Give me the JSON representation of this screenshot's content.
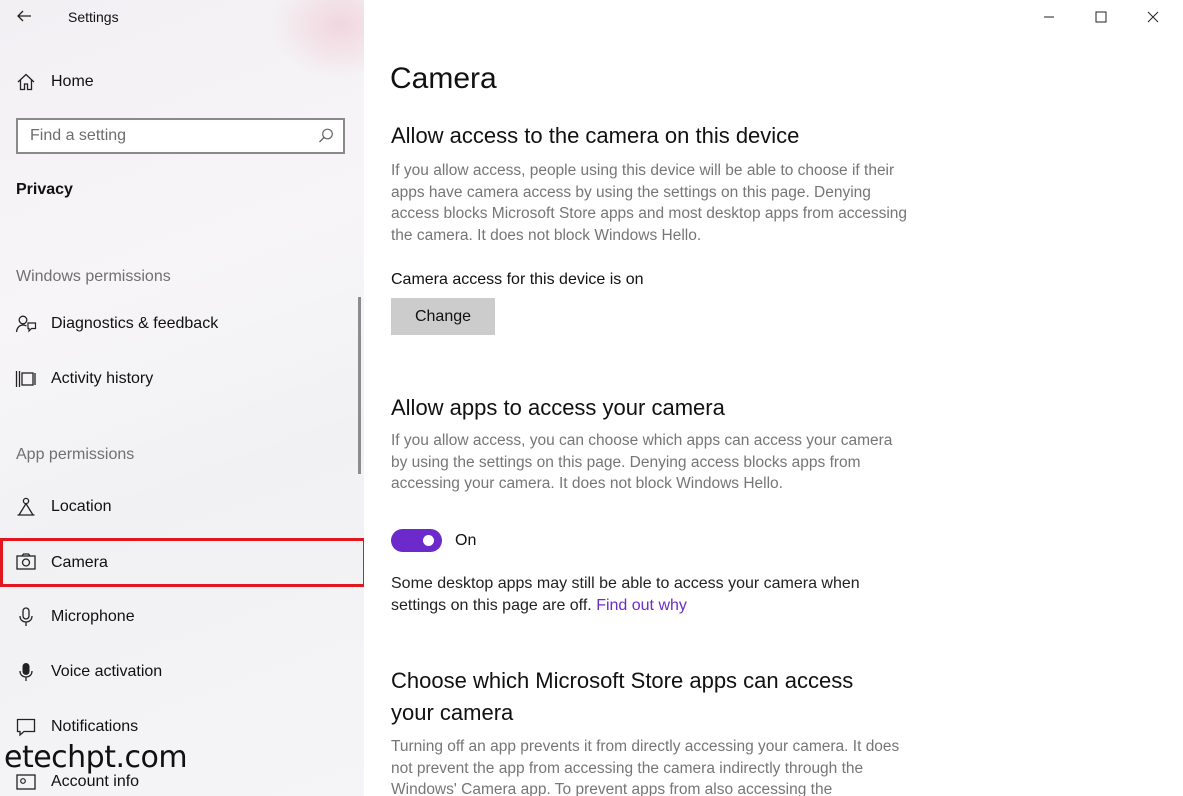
{
  "window": {
    "title": "Settings"
  },
  "sidebar": {
    "home_label": "Home",
    "search": {
      "placeholder": "Find a setting"
    },
    "section_title": "Privacy",
    "groups": {
      "windows_permissions": "Windows permissions",
      "app_permissions": "App permissions"
    },
    "items": [
      {
        "label": "Diagnostics & feedback",
        "icon": "feedback-icon"
      },
      {
        "label": "Activity history",
        "icon": "timeline-icon"
      },
      {
        "label": "Location",
        "icon": "location-icon"
      },
      {
        "label": "Camera",
        "icon": "camera-icon",
        "selected": true
      },
      {
        "label": "Microphone",
        "icon": "microphone-icon"
      },
      {
        "label": "Voice activation",
        "icon": "voice-activation-icon"
      },
      {
        "label": "Notifications",
        "icon": "notifications-icon"
      },
      {
        "label": "Account info",
        "icon": "account-info-icon"
      }
    ]
  },
  "watermark": "etechpt.com",
  "main": {
    "title": "Camera",
    "device_section": {
      "heading": "Allow access to the camera on this device",
      "description": "If you allow access, people using this device will be able to choose if their apps have camera access by using the settings on this page. Denying access blocks Microsoft Store apps and most desktop apps from accessing the camera. It does not block Windows Hello.",
      "status": "Camera access for this device is on",
      "button_label": "Change"
    },
    "apps_section": {
      "heading": "Allow apps to access your camera",
      "description": "If you allow access, you can choose which apps can access your camera by using the settings on this page. Denying access blocks apps from accessing your camera. It does not block Windows Hello.",
      "toggle_state": "On",
      "toggle_on": true,
      "note": "Some desktop apps may still be able to access your camera when settings on this page are off.",
      "link": "Find out why"
    },
    "store_section": {
      "heading": "Choose which Microsoft Store apps can access your camera",
      "description": "Turning off an app prevents it from directly accessing your camera. It does not prevent the app from accessing the camera indirectly through the Windows' Camera app. To prevent apps from also accessing the"
    }
  },
  "colors": {
    "accent": "#6b2ac9",
    "selection_border": "#e0171f",
    "link": "#6d2ec4"
  }
}
